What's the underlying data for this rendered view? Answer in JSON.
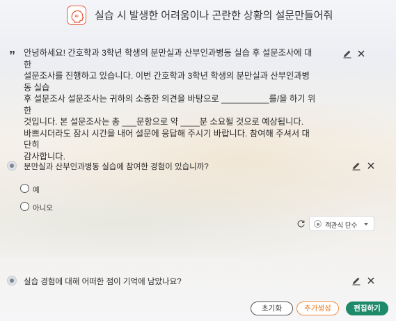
{
  "header": {
    "title": "실습 시 발생한 어려움이나 곤란한 상황의 설문만들어줘",
    "badge_text": "AI"
  },
  "intro": {
    "lines": [
      "안녕하세요! 간호학과 3학년 학생의 분만실과 산부인과병동 실습 후 설문조사에 대한",
      "설문조사를 진행하고 있습니다. 이번 간호학과 3학년 학생의 분만실과 산부인과병동 실습",
      "후 설문조사 설문조사는 귀하의 소중한 의견을 바탕으로 __________를/을 하기 위한",
      "것입니다. 본 설문조사는 총 ___문항으로 약 ____분 소요될 것으로 예상됩니다.",
      "바쁘시더라도 잠시 시간을 내어 설문에 응답해 주시기 바랍니다. 참여해 주셔서 대단히",
      "감사합니다."
    ]
  },
  "questions": [
    {
      "text": "분만실과 산부인과병동 실습에 참여한 경험이 있습니까?",
      "options": [
        "예",
        "아니오"
      ],
      "type_label": "객관식 단수"
    },
    {
      "text": "실습 경험에 대해 어떠한 점이 기억에 남았나요?"
    }
  ],
  "footer": {
    "reset_label": "초기화",
    "add_label": "추가생성",
    "edit_label": "편집하기"
  },
  "colors": {
    "badge_border": "#e25c3b",
    "add_button": "#f08a3c",
    "edit_button": "#1f8a6a"
  }
}
